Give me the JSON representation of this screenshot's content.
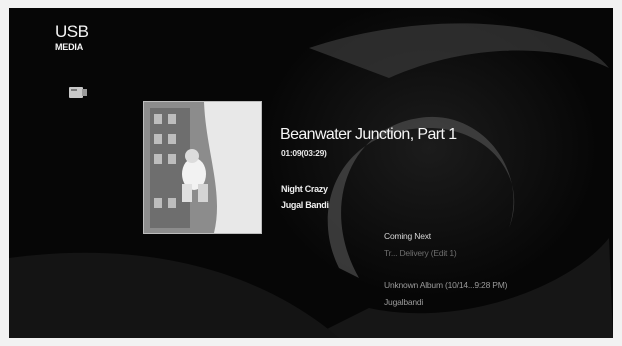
{
  "header": {
    "line1": "USB",
    "line2": "MEDIA",
    "device_icon": "usb-drive-icon"
  },
  "now_playing": {
    "cover_icon": "album-art",
    "title": "Beanwater Junction, Part 1",
    "time": "01:09(03:29)",
    "artist": "Night Crazy",
    "album": "Jugal Bandi"
  },
  "up_next": {
    "heading": "Coming Next",
    "title": "Tr... Delivery (Edit 1)",
    "album": "Unknown Album (10/14...9:28 PM)",
    "artist": "Jugalbandi"
  },
  "colors": {
    "background": "#060606",
    "text": "#f5f5f5",
    "dim_text": "#9a9a9a"
  }
}
